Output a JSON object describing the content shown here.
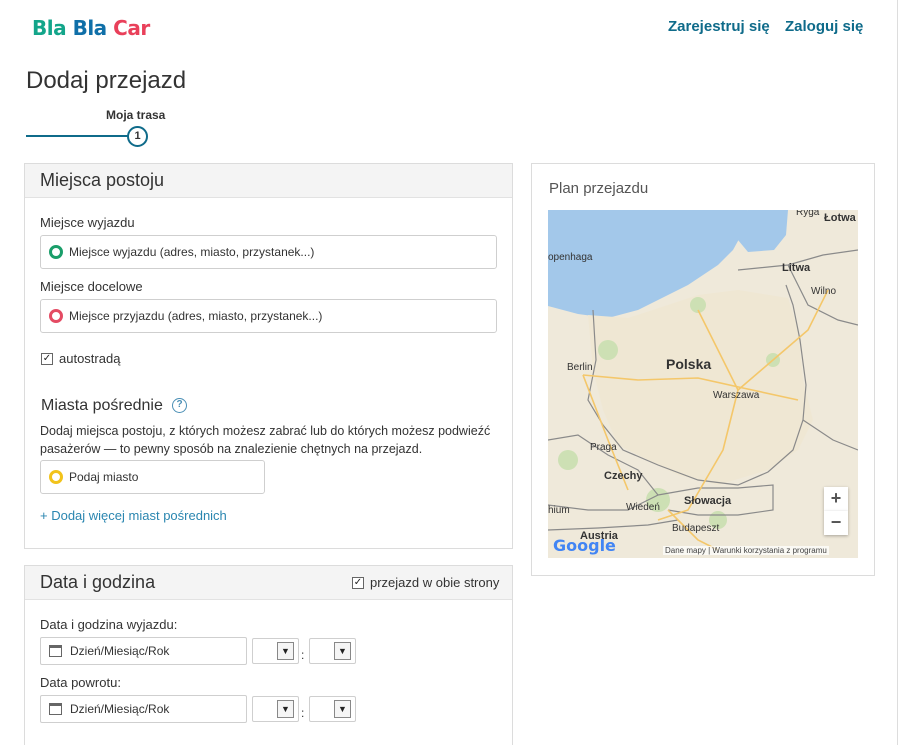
{
  "header": {
    "logo": {
      "part1": "Bla",
      "part2": "Bla",
      "part3": "Car"
    },
    "register": "Zarejestruj się",
    "login": "Zaloguj się"
  },
  "page_title": "Dodaj przejazd",
  "stepper": {
    "label": "Moja trasa",
    "number": "1"
  },
  "places": {
    "title": "Miejsca postoju",
    "departure_label": "Miejsce wyjazdu",
    "departure_placeholder": "Miejsce wyjazdu (adres, miasto, przystanek...)",
    "destination_label": "Miejsce docelowe",
    "destination_placeholder": "Miejsce przyjazdu (adres, miasto, przystanek...)",
    "highway_label": "autostradą",
    "highway_checked": true,
    "intermediate_title": "Miasta pośrednie",
    "help_symbol": "?",
    "intermediate_desc": "Dodaj miejsca postoju, z których możesz zabrać lub do których możesz podwieźć pasażerów — to pewny sposób na znalezienie chętnych na przejazd.",
    "intermediate_placeholder": "Podaj miasto",
    "add_more": "+ Dodaj więcej miast pośrednich",
    "colors": {
      "departure": "#1a9e6a",
      "destination": "#e44b63",
      "intermediate": "#f2c31b"
    }
  },
  "datetime": {
    "title": "Data i godzina",
    "round_trip_label": "przejazd w obie strony",
    "round_trip_checked": true,
    "departure_label": "Data i godzina wyjazdu:",
    "return_label": "Data powrotu:",
    "date_placeholder": "Dzień/Miesiąc/Rok",
    "colon": ":"
  },
  "map": {
    "title": "Plan przejazdu",
    "labels": {
      "polska": "Polska",
      "warszawa": "Warszawa",
      "berlin": "Berlin",
      "praga": "Praga",
      "czechy": "Czechy",
      "slowacja": "Słowacja",
      "wieden": "Wiedeń",
      "budapeszt": "Budapeszt",
      "austria": "Austria",
      "litwa": "Litwa",
      "wilno": "Wilno",
      "lotwa": "Łotwa",
      "ryga": "Ryga",
      "kopenhaga": "openhaga",
      "monachium": "hium"
    },
    "zoom_in": "+",
    "zoom_out": "−",
    "google": "Google",
    "attribution": "Dane mapy  |  Warunki korzystania z programu"
  }
}
